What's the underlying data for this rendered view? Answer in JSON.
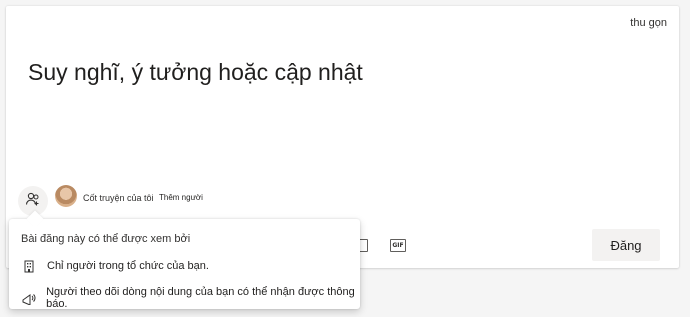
{
  "composer": {
    "collapse_label": "thu gọn",
    "prompt": "Suy nghĩ, ý tưởng hoặc cập nhật",
    "storyline_label": "Cốt truyện của tôi",
    "add_people_label": "Thêm người",
    "post_label": "Đăng",
    "gif_label": "GIF"
  },
  "audience_popup": {
    "title": "Bài đăng này có thể được xem bởi",
    "items": [
      {
        "icon": "building-icon",
        "label": "Chỉ người trong tổ chức của bạn."
      },
      {
        "icon": "broadcast-icon",
        "label": "Người theo dõi dòng nội dung của bạn có thể nhận được thông báo."
      }
    ]
  }
}
